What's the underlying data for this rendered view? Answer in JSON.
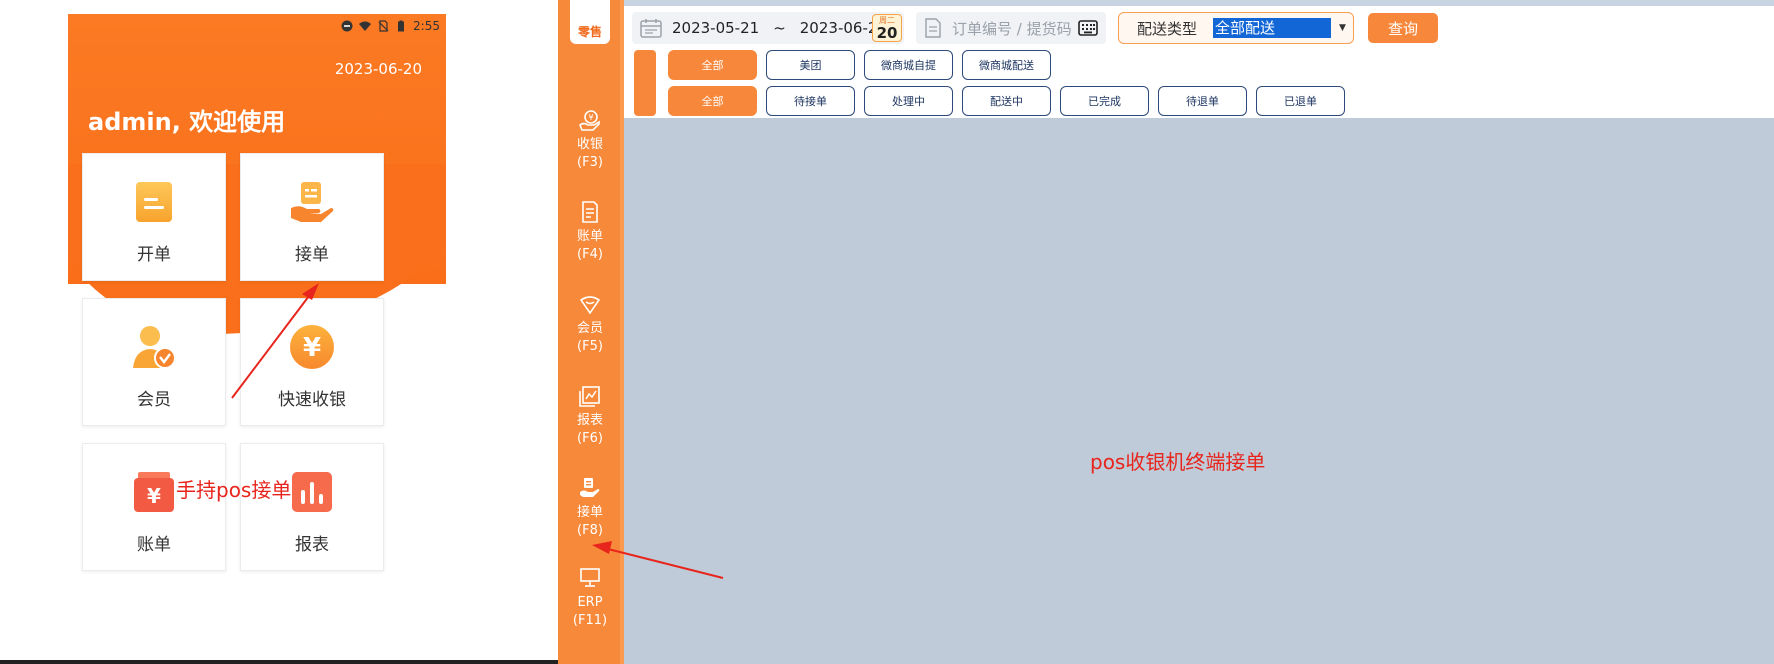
{
  "phone": {
    "status_time": "2:55",
    "date": "2023-06-20",
    "welcome": "admin, 欢迎使用",
    "tiles": [
      {
        "label": "开单"
      },
      {
        "label": "接单"
      },
      {
        "label": "会员"
      },
      {
        "label": "快速收银"
      },
      {
        "label": "账单"
      },
      {
        "label": "报表"
      }
    ],
    "caption": "手持pos接单"
  },
  "desktop": {
    "logo_text": "零售",
    "sidebar": [
      {
        "label": "收银",
        "key": "(F3)"
      },
      {
        "label": "账单",
        "key": "(F4)"
      },
      {
        "label": "会员",
        "key": "(F5)"
      },
      {
        "label": "报表",
        "key": "(F6)"
      },
      {
        "label": "接单",
        "key": "(F8)"
      },
      {
        "label": "ERP",
        "key": "(F11)"
      }
    ],
    "date_start": "2023-05-21",
    "date_sep": "~",
    "date_end": "2023-06-20",
    "date_badge_weekday": "周二",
    "date_badge_day": "20",
    "order_placeholder": "订单编号 / 提货码",
    "delivery_label": "配送类型",
    "delivery_value": "全部配送",
    "query_label": "查询",
    "channel_chips": [
      "全部",
      "美团",
      "微商城自提",
      "微商城配送"
    ],
    "status_chips": [
      "全部",
      "待接单",
      "处理中",
      "配送中",
      "已完成",
      "待退单",
      "已退单"
    ],
    "caption": "pos收银机终端接单"
  },
  "colors": {
    "brand_orange": "#f7873a",
    "caption_red": "#e8251c",
    "selection_blue": "#1266d6"
  }
}
